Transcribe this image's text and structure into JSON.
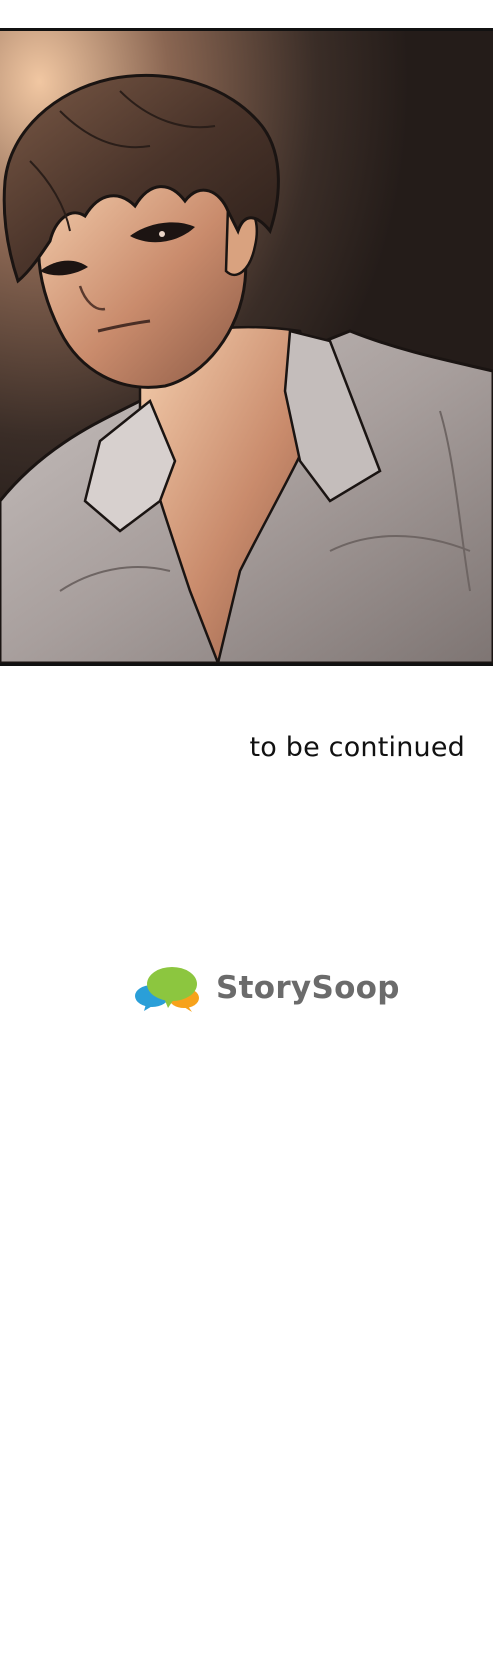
{
  "panel": {
    "subject": "manga-panel-man-in-white-shirt"
  },
  "ending": {
    "text": "to be continued"
  },
  "publisher": {
    "name": "StorySoop",
    "logo_icon": "speech-bubbles-logo-icon",
    "colors": {
      "blue": "#2a9fd8",
      "green": "#8cc63f",
      "orange": "#f7a21b",
      "text": "#6b6b6b"
    }
  }
}
